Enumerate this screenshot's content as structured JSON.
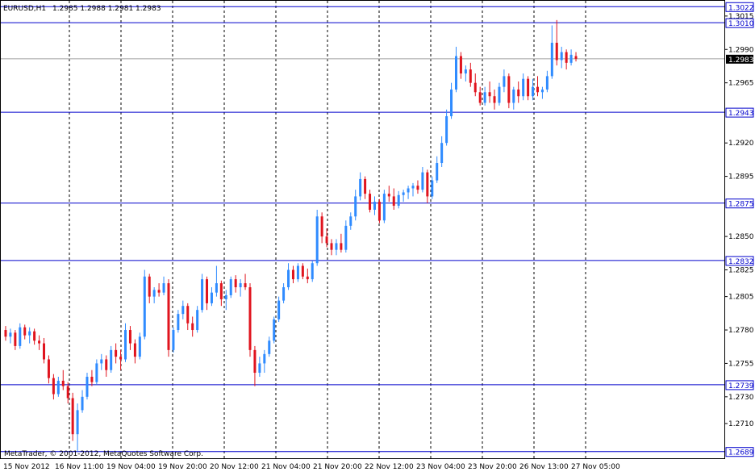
{
  "header": {
    "symbol": "EURUSD,H1",
    "ohlc": "1.2985 1.2988 1.2981 1.2983"
  },
  "footer": {
    "copyright": "MetaTrader, © 2001-2012, MetaQuotes Software Corp."
  },
  "colors": {
    "bull": "#2f8bff",
    "bear": "#e0141e",
    "level_line": "#0000cc",
    "grid": "#000000",
    "current_price_line": "#a0a0a0",
    "price_badge_bg": "#0000cc",
    "current_badge_bg": "#000000"
  },
  "chart_data": {
    "type": "candlestick",
    "symbol": "EURUSD",
    "timeframe": "H1",
    "ylim": [
      1.2684,
      1.3027
    ],
    "y_ticks": [
      "1.3015",
      "1.2990",
      "1.2965",
      "1.2920",
      "1.2895",
      "1.2850",
      "1.2825",
      "1.2805",
      "1.2780",
      "1.2755",
      "1.2730",
      "1.2710"
    ],
    "x_labels": [
      "15 Nov 2012",
      "16 Nov 11:00",
      "19 Nov 04:00",
      "19 Nov 20:00",
      "20 Nov 12:00",
      "21 Nov 04:00",
      "21 Nov 20:00",
      "22 Nov 12:00",
      "23 Nov 04:00",
      "23 Nov 20:00",
      "26 Nov 13:00",
      "27 Nov 05:00"
    ],
    "level_lines": [
      "1.3022",
      "1.3010",
      "1.2943",
      "1.2875",
      "1.2832",
      "1.2739",
      "1.2689"
    ],
    "current_price": "1.2983",
    "grid": "vertical dotted",
    "candles": [
      [
        1.278,
        1.2783,
        1.2772,
        1.2775
      ],
      [
        1.2775,
        1.2781,
        1.277,
        1.2778
      ],
      [
        1.2778,
        1.278,
        1.2765,
        1.2768
      ],
      [
        1.2768,
        1.2785,
        1.2766,
        1.2782
      ],
      [
        1.2782,
        1.2784,
        1.2773,
        1.2776
      ],
      [
        1.2776,
        1.2782,
        1.277,
        1.2779
      ],
      [
        1.2779,
        1.2781,
        1.2769,
        1.2772
      ],
      [
        1.2772,
        1.2776,
        1.2765,
        1.277
      ],
      [
        1.277,
        1.2774,
        1.2755,
        1.2758
      ],
      [
        1.2758,
        1.2761,
        1.274,
        1.2744
      ],
      [
        1.2744,
        1.2747,
        1.2728,
        1.2732
      ],
      [
        1.2732,
        1.2745,
        1.273,
        1.2742
      ],
      [
        1.2742,
        1.275,
        1.2735,
        1.2738
      ],
      [
        1.2738,
        1.2741,
        1.2725,
        1.2729
      ],
      [
        1.2729,
        1.2733,
        1.2697,
        1.2702
      ],
      [
        1.2702,
        1.2725,
        1.2689,
        1.272
      ],
      [
        1.272,
        1.2735,
        1.2718,
        1.273
      ],
      [
        1.273,
        1.2748,
        1.2728,
        1.2745
      ],
      [
        1.2745,
        1.275,
        1.2738,
        1.2741
      ],
      [
        1.2741,
        1.2758,
        1.2739,
        1.2755
      ],
      [
        1.2755,
        1.2762,
        1.275,
        1.2758
      ],
      [
        1.2758,
        1.2761,
        1.2745,
        1.275
      ],
      [
        1.275,
        1.2768,
        1.2748,
        1.2765
      ],
      [
        1.2765,
        1.277,
        1.2755,
        1.276
      ],
      [
        1.276,
        1.2765,
        1.275,
        1.2758
      ],
      [
        1.2758,
        1.2785,
        1.2756,
        1.278
      ],
      [
        1.278,
        1.2783,
        1.2765,
        1.277
      ],
      [
        1.277,
        1.2773,
        1.2755,
        1.276
      ],
      [
        1.276,
        1.2778,
        1.2758,
        1.2775
      ],
      [
        1.2775,
        1.2825,
        1.2773,
        1.282
      ],
      [
        1.282,
        1.2822,
        1.28,
        1.2805
      ],
      [
        1.2805,
        1.2812,
        1.28,
        1.281
      ],
      [
        1.281,
        1.2815,
        1.2805,
        1.2808
      ],
      [
        1.2808,
        1.282,
        1.2806,
        1.2815
      ],
      [
        1.2815,
        1.2818,
        1.276,
        1.2765
      ],
      [
        1.2765,
        1.2782,
        1.2763,
        1.278
      ],
      [
        1.278,
        1.2795,
        1.2778,
        1.2792
      ],
      [
        1.2792,
        1.2802,
        1.2788,
        1.2798
      ],
      [
        1.2798,
        1.28,
        1.278,
        1.2785
      ],
      [
        1.2785,
        1.279,
        1.2775,
        1.278
      ],
      [
        1.278,
        1.2798,
        1.2778,
        1.2795
      ],
      [
        1.2795,
        1.2822,
        1.2793,
        1.2818
      ],
      [
        1.2818,
        1.282,
        1.2795,
        1.28
      ],
      [
        1.28,
        1.2812,
        1.2798,
        1.2808
      ],
      [
        1.2808,
        1.2828,
        1.2805,
        1.2815
      ],
      [
        1.2815,
        1.2817,
        1.2798,
        1.2803
      ],
      [
        1.2803,
        1.281,
        1.2795,
        1.2806
      ],
      [
        1.2806,
        1.282,
        1.2804,
        1.2818
      ],
      [
        1.2818,
        1.2821,
        1.2808,
        1.2812
      ],
      [
        1.2812,
        1.2818,
        1.2805,
        1.2815
      ],
      [
        1.2815,
        1.2822,
        1.281,
        1.2812
      ],
      [
        1.2812,
        1.2815,
        1.276,
        1.2765
      ],
      [
        1.2765,
        1.2768,
        1.2738,
        1.2748
      ],
      [
        1.2748,
        1.276,
        1.2745,
        1.2755
      ],
      [
        1.2755,
        1.2765,
        1.2748,
        1.2762
      ],
      [
        1.2762,
        1.2775,
        1.276,
        1.2772
      ],
      [
        1.2772,
        1.279,
        1.277,
        1.2788
      ],
      [
        1.2788,
        1.2805,
        1.2786,
        1.2802
      ],
      [
        1.2802,
        1.2815,
        1.28,
        1.2812
      ],
      [
        1.2812,
        1.283,
        1.281,
        1.2825
      ],
      [
        1.2825,
        1.2828,
        1.2815,
        1.2818
      ],
      [
        1.2818,
        1.283,
        1.2816,
        1.2828
      ],
      [
        1.2828,
        1.283,
        1.2818,
        1.282
      ],
      [
        1.282,
        1.2826,
        1.2815,
        1.2818
      ],
      [
        1.2818,
        1.2832,
        1.2816,
        1.283
      ],
      [
        1.283,
        1.287,
        1.2828,
        1.2865
      ],
      [
        1.2865,
        1.2868,
        1.2845,
        1.285
      ],
      [
        1.285,
        1.2856,
        1.2842,
        1.2845
      ],
      [
        1.2845,
        1.2848,
        1.2836,
        1.284
      ],
      [
        1.284,
        1.2848,
        1.2836,
        1.2845
      ],
      [
        1.2845,
        1.2852,
        1.2838,
        1.284
      ],
      [
        1.284,
        1.2862,
        1.2838,
        1.2858
      ],
      [
        1.2858,
        1.2868,
        1.2855,
        1.2865
      ],
      [
        1.2865,
        1.2885,
        1.2862,
        1.288
      ],
      [
        1.288,
        1.2898,
        1.2877,
        1.2893
      ],
      [
        1.2893,
        1.2895,
        1.2878,
        1.2882
      ],
      [
        1.2882,
        1.2885,
        1.2868,
        1.287
      ],
      [
        1.287,
        1.288,
        1.2866,
        1.2876
      ],
      [
        1.2876,
        1.2878,
        1.286,
        1.2862
      ],
      [
        1.2862,
        1.2885,
        1.286,
        1.2882
      ],
      [
        1.2882,
        1.2888,
        1.2876,
        1.288
      ],
      [
        1.288,
        1.2886,
        1.287,
        1.2873
      ],
      [
        1.2873,
        1.2884,
        1.2871,
        1.2881
      ],
      [
        1.2881,
        1.2885,
        1.2876,
        1.2883
      ],
      [
        1.2883,
        1.2888,
        1.2878,
        1.2886
      ],
      [
        1.2886,
        1.289,
        1.288,
        1.2888
      ],
      [
        1.2888,
        1.2892,
        1.2882,
        1.2885
      ],
      [
        1.2885,
        1.2902,
        1.2883,
        1.2898
      ],
      [
        1.2898,
        1.29,
        1.2875,
        1.288
      ],
      [
        1.288,
        1.2895,
        1.2878,
        1.2892
      ],
      [
        1.2892,
        1.291,
        1.289,
        1.2905
      ],
      [
        1.2905,
        1.2925,
        1.2902,
        1.292
      ],
      [
        1.292,
        1.2945,
        1.2918,
        1.294
      ],
      [
        1.294,
        1.2965,
        1.2938,
        1.296
      ],
      [
        1.296,
        1.2992,
        1.2958,
        1.2985
      ],
      [
        1.2985,
        1.2988,
        1.2968,
        1.2972
      ],
      [
        1.2972,
        1.2978,
        1.2966,
        1.2975
      ],
      [
        1.2975,
        1.298,
        1.2962,
        1.2965
      ],
      [
        1.2965,
        1.2972,
        1.2955,
        1.2958
      ],
      [
        1.2958,
        1.2962,
        1.2948,
        1.295
      ],
      [
        1.295,
        1.2962,
        1.2948,
        1.2958
      ],
      [
        1.2958,
        1.2966,
        1.295,
        1.2955
      ],
      [
        1.2955,
        1.296,
        1.2945,
        1.295
      ],
      [
        1.295,
        1.2965,
        1.2948,
        1.2962
      ],
      [
        1.2962,
        1.2975,
        1.2958,
        1.297
      ],
      [
        1.297,
        1.2972,
        1.2946,
        1.295
      ],
      [
        1.295,
        1.2962,
        1.2945,
        1.296
      ],
      [
        1.296,
        1.2966,
        1.295,
        1.2955
      ],
      [
        1.2955,
        1.2972,
        1.2952,
        1.2968
      ],
      [
        1.2968,
        1.297,
        1.2952,
        1.2955
      ],
      [
        1.2955,
        1.2968,
        1.2952,
        1.2962
      ],
      [
        1.2962,
        1.297,
        1.2955,
        1.2958
      ],
      [
        1.2958,
        1.2962,
        1.2953,
        1.296
      ],
      [
        1.296,
        1.2974,
        1.2958,
        1.297
      ],
      [
        1.297,
        1.3008,
        1.2968,
        1.2995
      ],
      [
        1.2995,
        1.3012,
        1.2978,
        1.2982
      ],
      [
        1.2982,
        1.2992,
        1.2976,
        1.2988
      ],
      [
        1.2988,
        1.299,
        1.2975,
        1.298
      ],
      [
        1.298,
        1.299,
        1.2978,
        1.2986
      ],
      [
        1.2985,
        1.2988,
        1.2981,
        1.2983
      ]
    ]
  }
}
